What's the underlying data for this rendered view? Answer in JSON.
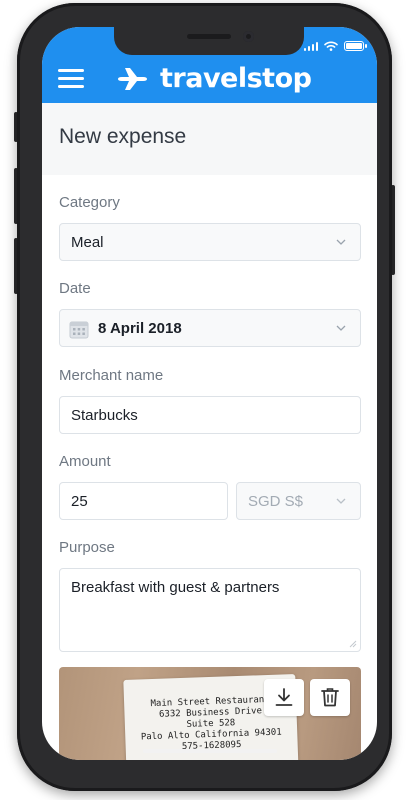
{
  "status_bar": {
    "icons": [
      "signal-icon",
      "wifi-icon",
      "battery-icon"
    ]
  },
  "app": {
    "brand": "travelstop",
    "brand_color": "#1f8fef",
    "menu_icon": "hamburger-icon",
    "logo_icon": "airplane-icon"
  },
  "page": {
    "title": "New expense"
  },
  "form": {
    "category": {
      "label": "Category",
      "value": "Meal"
    },
    "date": {
      "label": "Date",
      "value": "8 April 2018"
    },
    "merchant": {
      "label": "Merchant name",
      "value": "Starbucks"
    },
    "amount": {
      "label": "Amount",
      "value": "25",
      "currency": "SGD S$"
    },
    "purpose": {
      "label": "Purpose",
      "value": "Breakfast with guest & partners"
    }
  },
  "receipt": {
    "lines": [
      "Main Street Restaurant",
      "6332 Business Drive",
      "Suite 528",
      "Palo Alto California 94301",
      "575-1628095"
    ],
    "actions": [
      "download-icon",
      "trash-icon"
    ]
  }
}
